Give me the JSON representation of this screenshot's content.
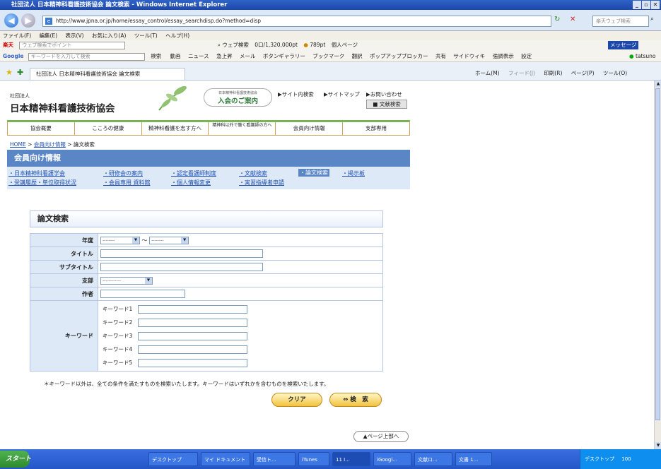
{
  "browser": {
    "window_title": "社団法人 日本精神科看護技術協会 論文検索 - Windows Internet Explorer",
    "url": "http://www.jpna.or.jp/home/essay_control/essay_searchdisp.do?method=disp",
    "search_placeholder": "楽天ウェブ検索",
    "menu": [
      "ファイル(F)",
      "編集(E)",
      "表示(V)",
      "お気に入り(A)",
      "ツール(T)",
      "ヘルプ(H)"
    ],
    "toolbar1": {
      "brand": "楽天",
      "point_placeholder": "ウェブ検索でポイント",
      "web_search": "ウェブ検索",
      "points": "0口/1,320,000pt",
      "pt": "789pt",
      "mypage": "個人ページ",
      "messenger": "メッセージ"
    },
    "toolbar2": {
      "google": "Google",
      "input_placeholder": "キーワードを入力して検索",
      "search_btn": "検索",
      "items": [
        "動画",
        "ニュース",
        "急上昇",
        "メール",
        "ボタンギャラリー",
        "ブックマーク",
        "翻訳",
        "ポップアップブロッカー",
        "共有",
        "サイドウィキ",
        "強調表示",
        "設定"
      ],
      "user": "tatsuno"
    },
    "tab_title": "社団法人 日本精神科看護技術協会 論文検索",
    "command_bar": [
      "ホーム(M)",
      "フィード(J)",
      "印刷(R)",
      "ページ(P)",
      "ツール(O)"
    ]
  },
  "site": {
    "org_type": "社団法人",
    "org_name": "日本精神科看護技術協会",
    "join_small": "日本精神科看護技術協会",
    "join_label": "入会のご案内",
    "top_links": [
      "▶サイト内検索",
      "▶サイトマップ",
      "▶お問い合わせ"
    ],
    "lit_search_btn": "文献検索",
    "main_nav": [
      "協会概要",
      "こころの健康",
      "精神科看護を志す方へ",
      "精神科以外で働く看護師の方へ",
      "会員向け情報",
      "支部専用"
    ],
    "breadcrumb": {
      "home": "HOME",
      "sep1": " > ",
      "members": "会員向け情報",
      "sep2": " > ",
      "current": "論文検索"
    },
    "section_title": "会員向け情報",
    "sub_nav": [
      "日本精神科看護学会",
      "研修会の案内",
      "認定看護師制度",
      "文献検索",
      "論文検索",
      "掲示板",
      "受講履歴・単位取得状況",
      "会員専用 資料館",
      "個人情報変更",
      "実習指導者申請"
    ],
    "form": {
      "title": "論文検索",
      "year_label": "年度",
      "year_from": "--------",
      "year_to": "--------",
      "tilde": "～",
      "title_label": "タイトル",
      "subtitle_label": "サブタイトル",
      "branch_label": "支部",
      "branch_value": "------------",
      "author_label": "作者",
      "keyword_label": "キーワード",
      "keywords": [
        "キーワード1",
        "キーワード2",
        "キーワード3",
        "キーワード4",
        "キーワード5"
      ]
    },
    "note": "＊キーワード以外は、全ての条件を満たすものを検索いたします。キーワードはいずれかを含むものを検索いたします。",
    "clear_btn": "クリア",
    "search_btn": "検　索",
    "page_top": "▲ページ上部へ"
  },
  "taskbar": {
    "start": "スタート",
    "items": [
      "デスクトップ",
      "マイ ドキュメント",
      "受信ト...",
      "iTunes",
      "11 I...",
      "iGoogl...",
      "文献ロ...",
      "文書 1..."
    ],
    "tray_text": "デスクトップ",
    "clock": "100"
  }
}
